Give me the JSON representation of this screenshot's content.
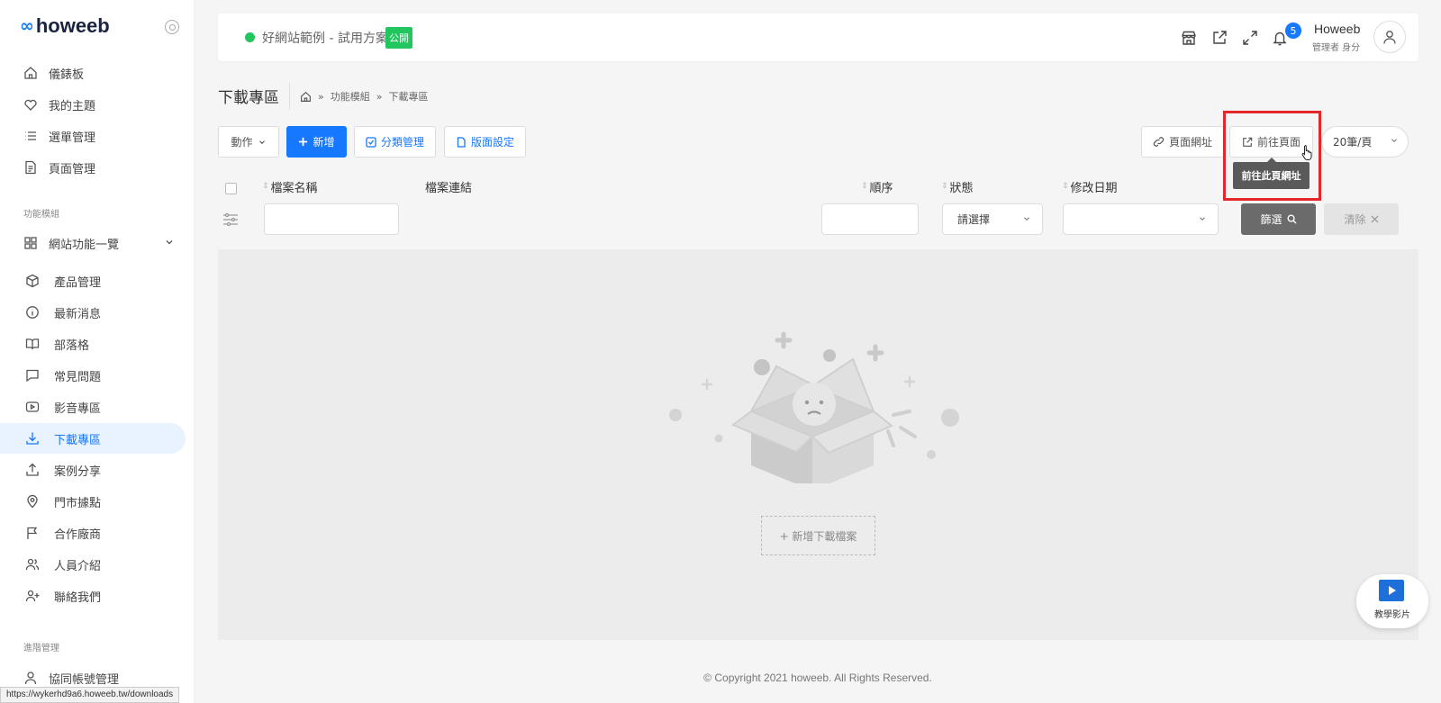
{
  "brand": {
    "logo_mark": "∞",
    "logo_text": "howeeb"
  },
  "sidebar": {
    "items_top": [
      {
        "label": "儀錶板",
        "icon": "home-icon"
      },
      {
        "label": "我的主題",
        "icon": "heart-icon"
      },
      {
        "label": "選單管理",
        "icon": "list-icon"
      },
      {
        "label": "頁面管理",
        "icon": "document-icon"
      }
    ],
    "section_modules": "功能模組",
    "group_label": "網站功能一覽",
    "items_modules": [
      {
        "label": "產品管理",
        "icon": "box-icon"
      },
      {
        "label": "最新消息",
        "icon": "info-icon"
      },
      {
        "label": "部落格",
        "icon": "book-icon"
      },
      {
        "label": "常見問題",
        "icon": "chat-icon"
      },
      {
        "label": "影音專區",
        "icon": "video-icon"
      },
      {
        "label": "下載專區",
        "icon": "download-icon"
      },
      {
        "label": "案例分享",
        "icon": "share-icon"
      },
      {
        "label": "門市據點",
        "icon": "location-icon"
      },
      {
        "label": "合作廠商",
        "icon": "flag-icon"
      },
      {
        "label": "人員介紹",
        "icon": "users-icon"
      },
      {
        "label": "聯絡我們",
        "icon": "user-plus-icon"
      }
    ],
    "section_advanced": "進階管理",
    "items_advanced": [
      {
        "label": "協同帳號管理",
        "icon": "user-icon"
      }
    ],
    "active": "下載專區"
  },
  "topbar": {
    "site_name": "好網站範例 - 試用方案",
    "public_badge": "公開",
    "notification_count": "5",
    "user_name": "Howeeb",
    "user_role": "管理者 身分",
    "status_color": "#22c55e",
    "accent_color": "#1677ff"
  },
  "page": {
    "title": "下載專區",
    "breadcrumb": [
      "功能模組",
      "下載專區"
    ]
  },
  "toolbar": {
    "action_label": "動作",
    "add_label": "新增",
    "category_label": "分類管理",
    "layout_label": "版面設定",
    "page_url_label": "頁面網址",
    "goto_page_label": "前往頁面",
    "page_size": "20筆/頁",
    "tooltip": "前往此頁網址"
  },
  "table": {
    "columns": {
      "filename": "檔案名稱",
      "link": "檔案連結",
      "order": "順序",
      "status": "狀態",
      "modified": "修改日期"
    },
    "filters": {
      "filename_value": "",
      "order_value": "",
      "status_value": "請選擇",
      "modified_value": ""
    },
    "filter_button": "篩選",
    "clear_button": "清除",
    "empty_add_label": "+ 新增下載檔案"
  },
  "footer": {
    "copyright": "© Copyright 2021 howeeb. All Rights Reserved."
  },
  "statusbar": {
    "url": "https://wykerhd9a6.howeeb.tw/downloads"
  },
  "tutorial": {
    "label": "教學影片"
  }
}
